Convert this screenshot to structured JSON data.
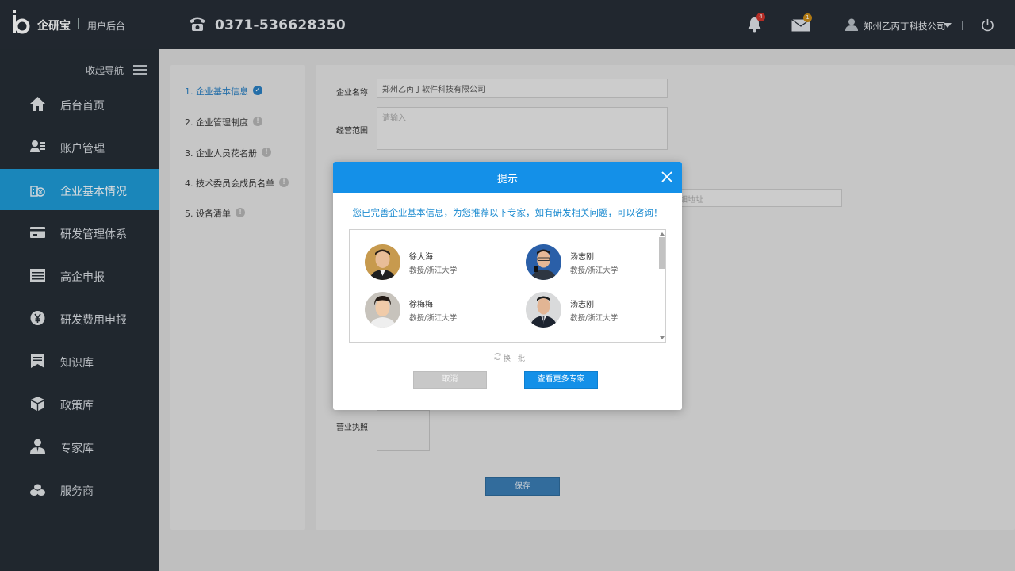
{
  "header": {
    "brand": "企研宝",
    "brand_sub": "用户后台",
    "phone": "0371-536628350",
    "notifications_count": "4",
    "messages_count": "1",
    "user_name": "郑州乙丙丁科技公司"
  },
  "sidebar": {
    "collapse_label": "收起导航",
    "items": [
      {
        "label": "后台首页",
        "icon": "home-icon"
      },
      {
        "label": "账户管理",
        "icon": "account-icon"
      },
      {
        "label": "企业基本情况",
        "icon": "company-icon",
        "active": true
      },
      {
        "label": "研发管理体系",
        "icon": "card-icon"
      },
      {
        "label": "高企申报",
        "icon": "list-icon"
      },
      {
        "label": "研发费用申报",
        "icon": "yen-icon"
      },
      {
        "label": "知识库",
        "icon": "bookmark-icon"
      },
      {
        "label": "政策库",
        "icon": "cube-icon"
      },
      {
        "label": "专家库",
        "icon": "expert-icon"
      },
      {
        "label": "服务商",
        "icon": "coins-icon"
      }
    ],
    "accent_color": "#1e9ad6"
  },
  "steps": [
    {
      "label": "1. 企业基本信息",
      "status": "done"
    },
    {
      "label": "2. 企业管理制度",
      "status": "pending"
    },
    {
      "label": "3. 企业人员花名册",
      "status": "pending"
    },
    {
      "label": "4. 技术委员会成员名单",
      "status": "pending"
    },
    {
      "label": "5. 设备清单",
      "status": "pending"
    }
  ],
  "form": {
    "company_name_label": "企业名称",
    "company_name_value": "郑州乙丙丁软件科技有限公司",
    "business_scope_label": "经营范围",
    "business_scope_placeholder": "请输入",
    "address_placeholder_partial": "细地址",
    "license_label": "营业执照",
    "save_label": "保存"
  },
  "modal": {
    "title": "提示",
    "message": "您已完善企业基本信息，为您推荐以下专家，如有研发相关问题，可以咨询！",
    "experts": [
      {
        "name": "徐大海",
        "title": "教授/浙江大学"
      },
      {
        "name": "汤志刚",
        "title": "教授/浙江大学"
      },
      {
        "name": "徐梅梅",
        "title": "教授/浙江大学"
      },
      {
        "name": "汤志刚",
        "title": "教授/浙江大学"
      }
    ],
    "refresh_label": "换一批",
    "cancel_label": "取消",
    "more_label": "查看更多专家",
    "header_color": "#1490e8"
  }
}
